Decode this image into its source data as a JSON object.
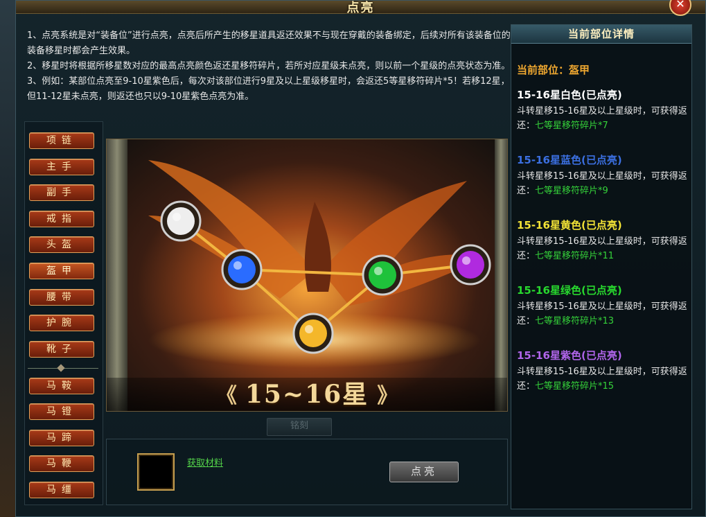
{
  "window": {
    "title": "点亮",
    "close_icon": "close-icon"
  },
  "description": [
    "1、点亮系统是对“装备位”进行点亮，点亮后所产生的移星道具返还效果不与现在穿戴的装备绑定，后续对所有该装备位的装备移星时都会产生效果。",
    "2、移星时将根据所移星数对应的最高点亮颜色返还星移符碎片，若所对应星级未点亮，则以前一个星级的点亮状态为准。",
    "3、例如：某部位点亮至9-10星紫色后，每次对该部位进行9星及以上星级移星时，会返还5等星移符碎片*5！若移12星，但11-12星未点亮，则返还也只以9-10星紫色点亮为准。"
  ],
  "slots": [
    "项链",
    "主手",
    "副手",
    "戒指",
    "头盔",
    "盔甲",
    "腰带",
    "护腕",
    "靴子",
    "马鞍",
    "马镫",
    "马蹄",
    "马鞭",
    "马缰"
  ],
  "active_slot": "盔甲",
  "picture": {
    "star_range": "15~16星",
    "orbs": [
      {
        "color": "white",
        "fill": "#eeeeee",
        "lit": true
      },
      {
        "color": "blue",
        "fill": "#2a6cff",
        "lit": true
      },
      {
        "color": "yellow",
        "fill": "#f4b72a",
        "lit": true
      },
      {
        "color": "green",
        "fill": "#1fc23b",
        "lit": true
      },
      {
        "color": "purple",
        "fill": "#b02adf",
        "lit": true
      }
    ]
  },
  "bottom": {
    "get_material": "获取材料",
    "light_button": "点亮",
    "faded_tab": "铭刻"
  },
  "detail": {
    "header": "当前部位详情",
    "current_part": "当前部位：盔甲",
    "tiers": [
      {
        "title": "15-16星白色(已点亮)",
        "color": "#ffffff",
        "desc": "斗转星移15-16星及以上星级时，可获得返还：",
        "reward": "七等星移符碎片*7"
      },
      {
        "title": "15-16星蓝色(已点亮)",
        "color": "#3b6fe0",
        "desc": "斗转星移15-16星及以上星级时，可获得返还：",
        "reward": "七等星移符碎片*9"
      },
      {
        "title": "15-16星黄色(已点亮)",
        "color": "#f2e236",
        "desc": "斗转星移15-16星及以上星级时，可获得返还：",
        "reward": "七等星移符碎片*11"
      },
      {
        "title": "15-16星绿色(已点亮)",
        "color": "#28d82e",
        "desc": "斗转星移15-16星及以上星级时，可获得返还：",
        "reward": "七等星移符碎片*13"
      },
      {
        "title": "15-16星紫色(已点亮)",
        "color": "#b065ea",
        "desc": "斗转星移15-16星及以上星级时，可获得返还：",
        "reward": "七等星移符碎片*15"
      }
    ]
  },
  "colors": {
    "accent_orange": "#f0a830",
    "reward_green": "#35d33a",
    "button_red": "#a83a18"
  }
}
